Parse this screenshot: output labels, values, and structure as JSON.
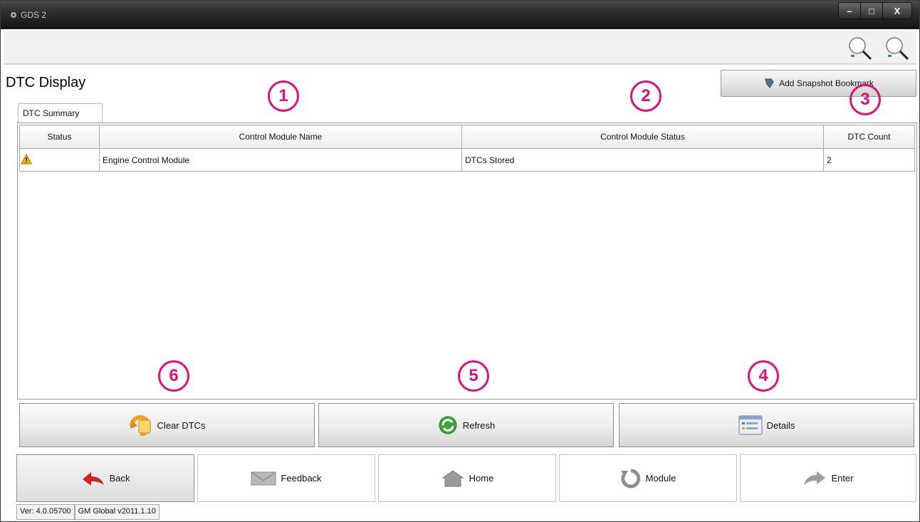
{
  "window": {
    "title": "GDS 2",
    "minimize": "–",
    "maximize": "□",
    "close": "X"
  },
  "toolbar": {
    "icons": [
      "zoom-in-icon",
      "zoom-out-icon"
    ]
  },
  "page": {
    "title": "DTC Display",
    "snapshot_button": "Add Snapshot Bookmark"
  },
  "tabs": [
    {
      "label": "DTC Summary"
    }
  ],
  "table": {
    "columns": [
      "Status",
      "Control Module Name",
      "Control Module Status",
      "DTC Count"
    ],
    "rows": [
      {
        "status_icon": "warning-icon",
        "name": "Engine Control Module",
        "module_status": "DTCs Stored",
        "dtc_count": "2"
      }
    ]
  },
  "actions": {
    "clear": "Clear DTCs",
    "refresh": "Refresh",
    "details": "Details"
  },
  "nav": {
    "back": "Back",
    "feedback": "Feedback",
    "home": "Home",
    "module": "Module",
    "enter": "Enter"
  },
  "status": {
    "version": "Ver: 4.0.05700",
    "global": "GM Global v2011.1.10"
  },
  "callouts": [
    "1",
    "2",
    "3",
    "4",
    "5",
    "6"
  ],
  "colors": {
    "callout": "#e0107a",
    "titlebar": "#2b2b2b"
  }
}
